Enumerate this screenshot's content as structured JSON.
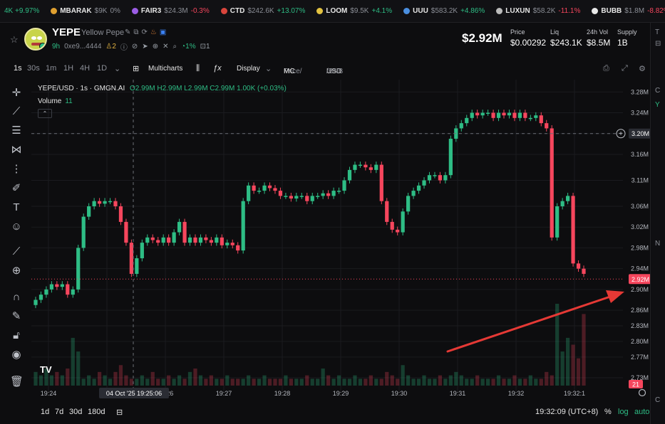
{
  "ticker": [
    {
      "symbol": "",
      "mc": "",
      "change": "4K +9.97%",
      "dir": "up",
      "color": ""
    },
    {
      "symbol": "MBARAK",
      "mc": "$9K",
      "change": "0%",
      "dir": "flat",
      "color": "#e0a030"
    },
    {
      "symbol": "FAIR3",
      "mc": "$24.3M",
      "change": "-0.3%",
      "dir": "down",
      "color": "#9b5de5"
    },
    {
      "symbol": "CTD",
      "mc": "$242.6K",
      "change": "+13.07%",
      "dir": "up",
      "color": "#d9453c"
    },
    {
      "symbol": "LOOM",
      "mc": "$9.5K",
      "change": "+4.1%",
      "dir": "up",
      "color": "#e3c341"
    },
    {
      "symbol": "UUU",
      "mc": "$583.2K",
      "change": "+4.86%",
      "dir": "up",
      "color": "#4a8fe0"
    },
    {
      "symbol": "LUXUN",
      "mc": "$58.2K",
      "change": "-11.1%",
      "dir": "down",
      "color": "#bbbbbb"
    },
    {
      "symbol": "BUBB",
      "mc": "$1.8M",
      "change": "-8.82%",
      "dir": "down",
      "color": "#e9e9e9"
    }
  ],
  "token": {
    "symbol": "YEPE",
    "name": "Yellow Pepe",
    "age": "9h",
    "address": "0xe9...4444",
    "holders": "2",
    "holder_pct": "1%",
    "extra_count": "1"
  },
  "stats": {
    "market_cap": "$2.92M",
    "price_label": "Price",
    "price": "$0.00292",
    "liq_label": "Liq",
    "liq": "$243.1K",
    "vol_label": "24h Vol",
    "vol": "$8.5M",
    "supply_label": "Supply",
    "supply": "1B"
  },
  "toolbar": {
    "intervals": [
      "1s",
      "30s",
      "1m",
      "1H",
      "4H",
      "1D"
    ],
    "selected_interval": "1s",
    "multicharts": "Multicharts",
    "display": "Display",
    "price_mc": "Price/",
    "mc": "MC",
    "usd_bnb": "USD",
    "bnb": "/BNB"
  },
  "legend": {
    "name": "YEPE/USD · 1s · GMGN.AI",
    "ohlc": "O2.99M H2.99M L2.99M C2.99M 1.00K (+0.03%)",
    "volume_label": "Volume",
    "volume_value": "11"
  },
  "chart_data": {
    "type": "candlestick",
    "y_ticks": [
      "3.28M",
      "3.24M",
      "3.20M",
      "3.16M",
      "3.11M",
      "3.06M",
      "3.02M",
      "2.98M",
      "2.94M",
      "2.90M",
      "2.86M",
      "2.83M",
      "2.80M",
      "2.77M",
      "2.73M"
    ],
    "x_ticks": [
      "19:24",
      "19:25",
      "19:26",
      "19:27",
      "19:28",
      "19:29",
      "19:30",
      "19:31",
      "19:32",
      "19:32:1"
    ],
    "ylim": [
      2.715,
      3.29
    ],
    "unit": "M",
    "crosshair_price": "3.20M",
    "crosshair_time": "04 Oct '25   19:25:06",
    "last_price": "2.92M",
    "volume_last": "21",
    "up_color": "#2ebd85",
    "down_color": "#f6465d",
    "candles_close": [
      2.88,
      2.89,
      2.9,
      2.91,
      2.905,
      2.91,
      2.89,
      2.9,
      2.98,
      3.04,
      3.06,
      3.07,
      3.065,
      3.07,
      3.07,
      3.06,
      3.03,
      2.99,
      2.93,
      2.96,
      2.99,
      3.0,
      2.995,
      2.99,
      3.0,
      2.99,
      3.01,
      3.03,
      2.99,
      3.0,
      2.99,
      3.0,
      2.995,
      2.99,
      3.0,
      2.985,
      2.99,
      2.985,
      2.975,
      3.07,
      3.1,
      3.09,
      3.09,
      3.1,
      3.095,
      3.09,
      3.08,
      3.08,
      3.075,
      3.08,
      3.08,
      3.07,
      3.08,
      3.08,
      3.085,
      3.08,
      3.09,
      3.09,
      3.11,
      3.13,
      3.14,
      3.14,
      3.135,
      3.13,
      3.14,
      3.07,
      3.03,
      3.015,
      3.01,
      3.05,
      3.08,
      3.09,
      3.1,
      3.11,
      3.12,
      3.12,
      3.11,
      3.12,
      3.19,
      3.21,
      3.22,
      3.23,
      3.24,
      3.235,
      3.24,
      3.24,
      3.23,
      3.24,
      3.235,
      3.24,
      3.23,
      3.24,
      3.23,
      3.23,
      3.235,
      3.22,
      3.21,
      3.0,
      3.06,
      3.07,
      3.08,
      2.95,
      2.94,
      2.93
    ],
    "volumes": [
      4,
      3,
      5,
      3,
      4,
      3,
      5,
      14,
      10,
      2,
      3,
      2,
      4,
      3,
      2,
      4,
      6,
      3,
      2,
      2,
      3,
      2,
      4,
      2,
      2,
      3,
      2,
      3,
      2,
      4,
      5,
      3,
      2,
      3,
      2,
      2,
      3,
      2,
      2,
      2,
      3,
      2,
      2,
      3,
      2,
      2,
      2,
      3,
      2,
      2,
      2,
      3,
      2,
      2,
      5,
      3,
      2,
      3,
      2,
      2,
      3,
      2,
      2,
      3,
      2,
      2,
      4,
      3,
      2,
      6,
      3,
      2,
      2,
      3,
      2,
      2,
      3,
      2,
      3,
      4,
      3,
      2,
      2,
      3,
      2,
      2,
      2,
      3,
      2,
      2,
      3,
      2,
      2,
      3,
      2,
      2,
      4,
      3,
      24,
      10,
      14,
      12,
      8,
      21
    ]
  },
  "annotation": {
    "arrow_color": "#e53935"
  },
  "bottombar": {
    "ranges": [
      "1d",
      "7d",
      "30d",
      "180d"
    ],
    "time": "19:32:09 (UTC+8)",
    "pct": "%",
    "log": "log",
    "auto": "auto"
  },
  "right_panel": {
    "letters": [
      "T",
      "C",
      "Y",
      "N",
      "C"
    ]
  }
}
